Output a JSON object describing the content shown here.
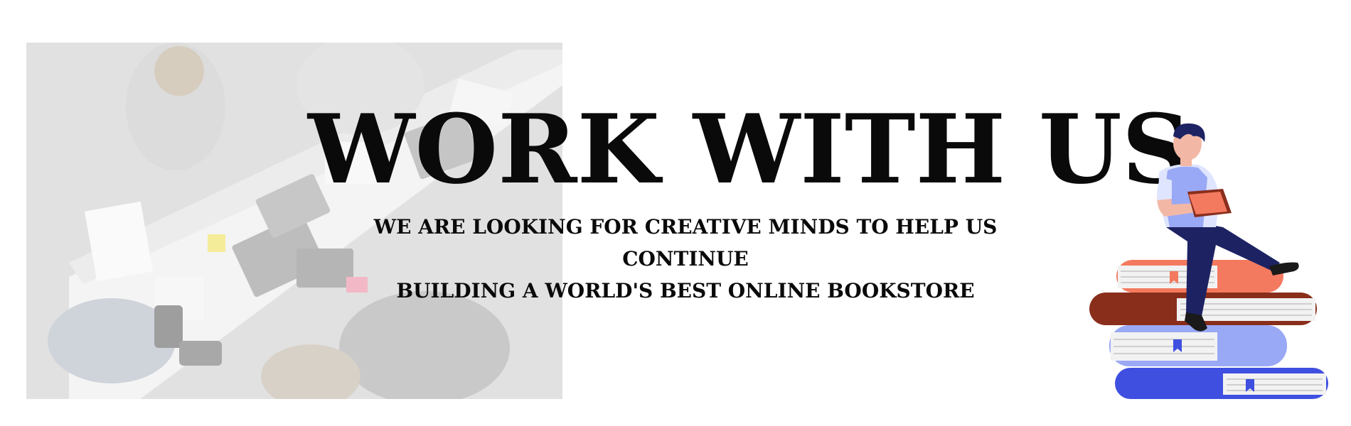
{
  "banner": {
    "title": "WORK WITH US",
    "subtitle_line1": "WE ARE LOOKING FOR CREATIVE MINDS TO HELP US CONTINUE",
    "subtitle_line2": "BUILDING A WORLD'S BEST ONLINE BOOKSTORE"
  },
  "photo": {
    "icon": "team-meeting-photo"
  },
  "illustration": {
    "icon": "person-reading-on-books-icon",
    "colors": {
      "book_orange": "#f47a5f",
      "book_brown": "#8a2e1c",
      "book_lightblue": "#9aa9f5",
      "book_blue": "#3f4fe0",
      "pants": "#1d2263",
      "vest": "#9aa9f5",
      "shirt": "#dfe5ff"
    }
  }
}
